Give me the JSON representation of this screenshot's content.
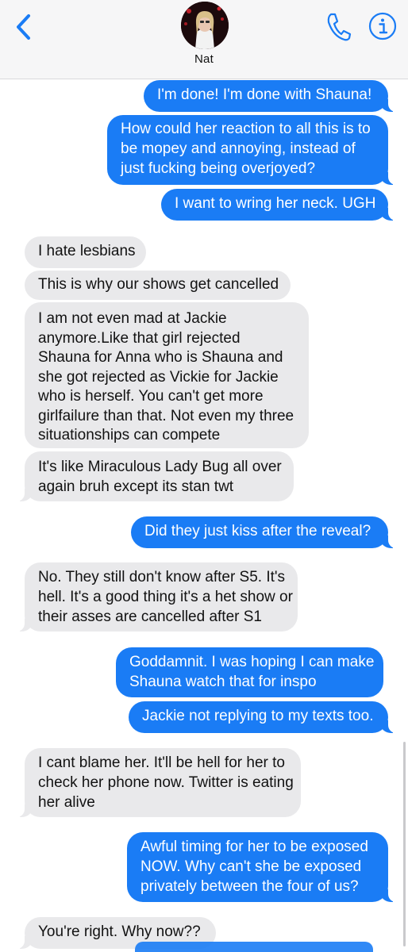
{
  "header": {
    "contact_name": "Nat",
    "back_icon": "chevron-left-icon",
    "phone_icon": "phone-icon",
    "info_icon": "info-icon",
    "accent_color": "#1a7cf5"
  },
  "messages": [
    {
      "from": "me",
      "lines": [
        "I'm done! I'm done with Shauna!"
      ]
    },
    {
      "from": "me",
      "lines": [
        "How could her reaction to all this is to",
        "be mopey and annoying, instead of",
        "just fucking being overjoyed?"
      ]
    },
    {
      "from": "me",
      "lines": [
        "I want to wring her neck. UGH"
      ]
    },
    {
      "from": "them",
      "lines": [
        "I hate lesbians"
      ]
    },
    {
      "from": "them",
      "lines": [
        "This is why our shows get cancelled"
      ]
    },
    {
      "from": "them",
      "lines": [
        "I am not even mad at Jackie",
        "anymore.Like that girl rejected",
        "Shauna for Anna who is Shauna and",
        "she got rejected as Vickie for Jackie",
        "who is herself. You can't get more",
        "girlfailure than that. Not even my three",
        "situationships can compete"
      ]
    },
    {
      "from": "them",
      "lines": [
        "It's like Miraculous Lady Bug all over",
        "again bruh except its stan twt"
      ]
    },
    {
      "from": "me",
      "lines": [
        "Did they just kiss  after the reveal?"
      ]
    },
    {
      "from": "them",
      "lines": [
        "No. They still don't know after S5. It's",
        "hell. It's a good thing it's a het show or",
        "their asses are cancelled after S1"
      ]
    },
    {
      "from": "me",
      "lines": [
        "Goddamnit. I was hoping I can make",
        "Shauna watch that for inspo"
      ]
    },
    {
      "from": "me",
      "lines": [
        "Jackie not replying to my texts too."
      ]
    },
    {
      "from": "them",
      "lines": [
        "I cant blame her. It'll be hell for her to",
        "check her phone now. Twitter is eating",
        "her alive"
      ]
    },
    {
      "from": "me",
      "lines": [
        "Awful timing for her to be exposed",
        "NOW. Why can't she be exposed",
        "privately between the four of us?"
      ]
    },
    {
      "from": "them",
      "lines": [
        "You're right. Why now??"
      ]
    }
  ]
}
